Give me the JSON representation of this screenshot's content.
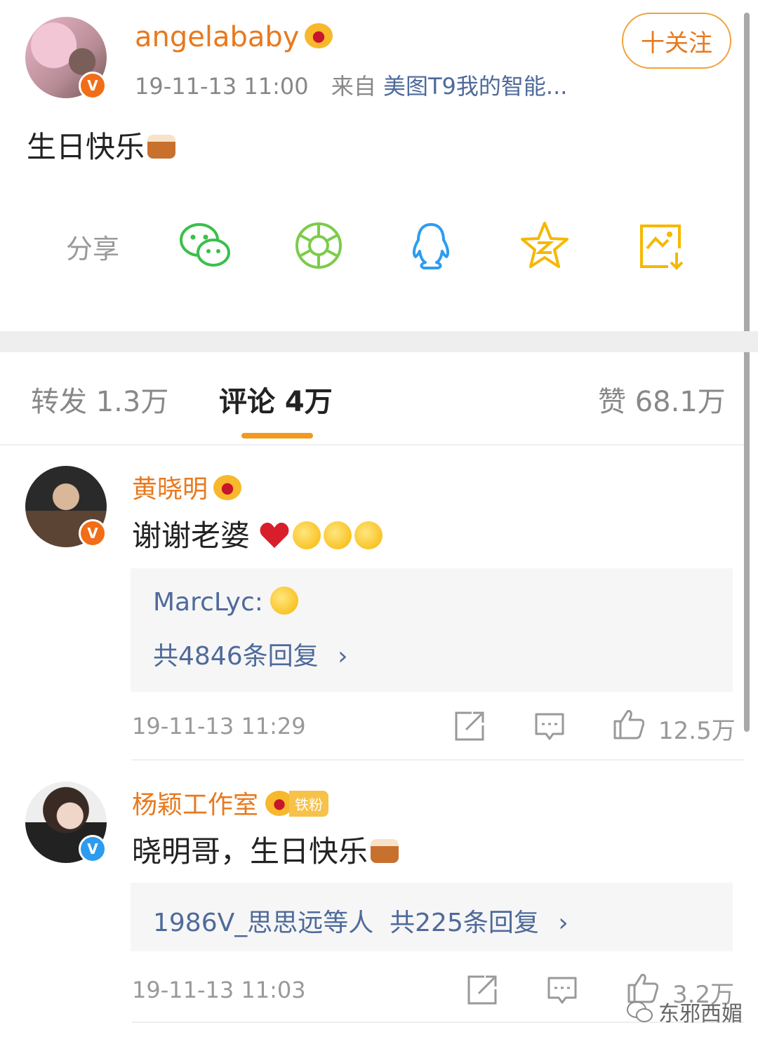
{
  "post": {
    "username": "angelababy",
    "time": "19-11-13 11:00",
    "source_prefix": "来自",
    "source": "美图T9我的智能...",
    "follow_label": "十关注",
    "text": "生日快乐"
  },
  "share": {
    "label": "分享",
    "icons": [
      "wechat-icon",
      "moments-icon",
      "qq-icon",
      "qzone-icon",
      "save-image-icon"
    ]
  },
  "tabs": {
    "repost": "转发 1.3万",
    "comments": "评论 4万",
    "likes": "赞 68.1万"
  },
  "comments": [
    {
      "name": "黄晓明",
      "text": "谢谢老婆",
      "reply_user": "MarcLyc:",
      "reply_count": "共4846条回复",
      "time": "19-11-13 11:29",
      "likes": "12.5万"
    },
    {
      "name": "杨颖工作室",
      "fan_badge": "铁粉",
      "text": "晓明哥，生日快乐",
      "reply_summary": "1986V_思思远等人  共225条回复",
      "time": "19-11-13 11:03",
      "likes": "3.2万"
    }
  ],
  "chevron": "›",
  "watermark": "东邪西媚",
  "colors": {
    "accent_orange": "#e8791e",
    "link_blue": "#4e6a9a",
    "tab_underline": "#f09a1f"
  }
}
